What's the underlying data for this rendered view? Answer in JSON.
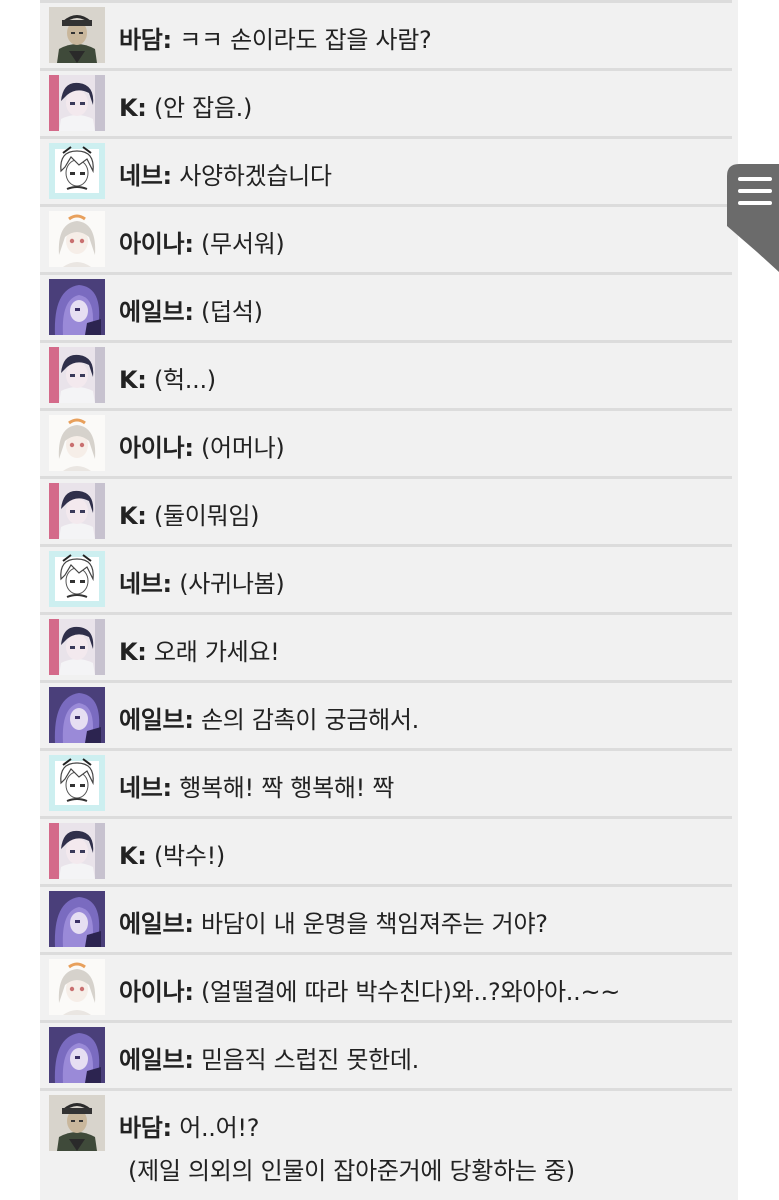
{
  "messages": [
    {
      "speaker": "바담:",
      "text": "ㅋㅋ 손이라도 잡을 사람?",
      "avatar": "badam"
    },
    {
      "speaker": "K:",
      "text": "(안 잡음.)",
      "avatar": "k"
    },
    {
      "speaker": "네브:",
      "text": "사양하겠습니다",
      "avatar": "neve"
    },
    {
      "speaker": "아이나:",
      "text": "(무서워)",
      "avatar": "aina"
    },
    {
      "speaker": "에일브:",
      "text": "(덥석)",
      "avatar": "eilv"
    },
    {
      "speaker": "K:",
      "text": "(헉...)",
      "avatar": "k"
    },
    {
      "speaker": "아이나:",
      "text": "(어머나)",
      "avatar": "aina"
    },
    {
      "speaker": "K:",
      "text": "(둘이뭐임)",
      "avatar": "k"
    },
    {
      "speaker": "네브:",
      "text": "(사귀나봄)",
      "avatar": "neve"
    },
    {
      "speaker": "K:",
      "text": "오래 가세요!",
      "avatar": "k"
    },
    {
      "speaker": "에일브:",
      "text": "손의 감촉이 궁금해서.",
      "avatar": "eilv"
    },
    {
      "speaker": "네브:",
      "text": "행복해! 짝 행복해! 짝",
      "avatar": "neve"
    },
    {
      "speaker": "K:",
      "text": "(박수!)",
      "avatar": "k"
    },
    {
      "speaker": "에일브:",
      "text": "바담이 내 운명을 책임져주는 거야?",
      "avatar": "eilv"
    },
    {
      "speaker": "아이나:",
      "text": "(얼떨결에 따라 박수친다)와..?와아아..~~",
      "avatar": "aina"
    },
    {
      "speaker": "에일브:",
      "text": "믿음직 스럽진 못한데.",
      "avatar": "eilv"
    },
    {
      "speaker": "바담:",
      "text": "어..어!?",
      "avatar": "badam",
      "sub": "(제일 의외의 인물이 잡아준거에 당황하는 중)"
    }
  ],
  "menu": {
    "icon": "hamburger-menu-icon"
  },
  "colors": {
    "background": "#f1f1f1",
    "divider": "#dcdcdc",
    "menu_tab": "#6b6b6b"
  }
}
